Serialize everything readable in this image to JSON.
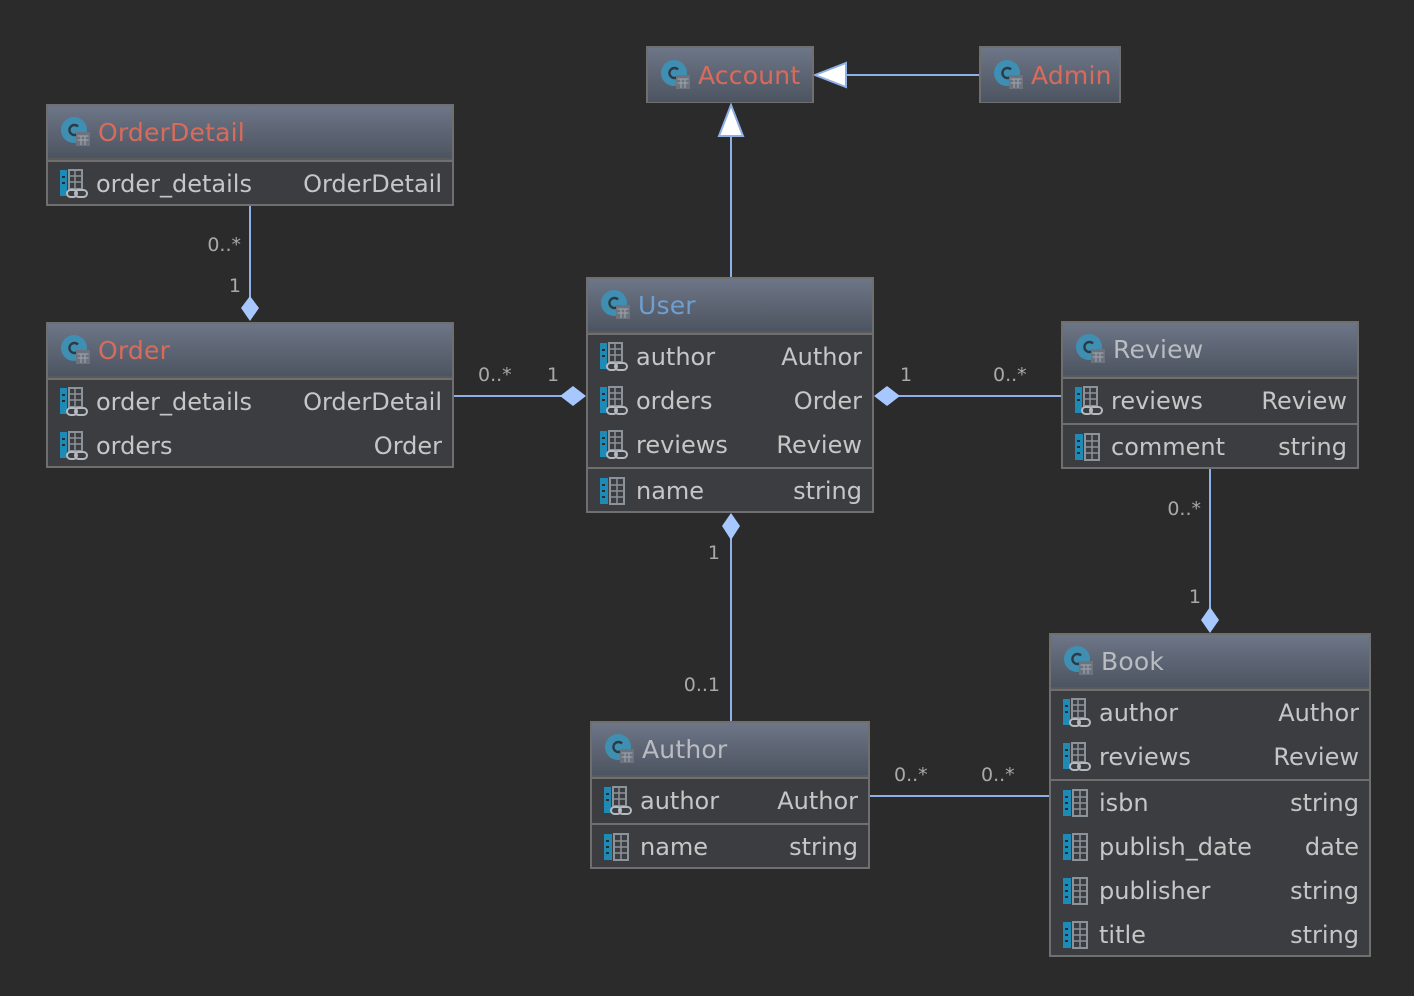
{
  "diagram": {
    "colors": {
      "background": "#2b2b2b",
      "edge": "#8fb0e6",
      "marker_fill": "#a7c7ff",
      "title_red": "#d96b5b",
      "title_blue": "#6f9fcf",
      "title_grey": "#b9bcc0",
      "text": "#c6c6c6",
      "label": "#a9a9a9"
    },
    "nodes": {
      "account": {
        "title": "Account",
        "title_style": "red",
        "icon": "class-icon"
      },
      "admin": {
        "title": "Admin",
        "title_style": "red",
        "icon": "class-icon"
      },
      "order_detail": {
        "title": "OrderDetail",
        "title_style": "red",
        "icon": "class-icon",
        "sections": [
          [
            {
              "name": "order_details",
              "type": "OrderDetail",
              "icon": "relation-field-icon"
            }
          ]
        ]
      },
      "order": {
        "title": "Order",
        "title_style": "red",
        "icon": "class-icon",
        "sections": [
          [
            {
              "name": "order_details",
              "type": "OrderDetail",
              "icon": "relation-field-icon"
            },
            {
              "name": "orders",
              "type": "Order",
              "icon": "relation-field-icon"
            }
          ]
        ]
      },
      "user": {
        "title": "User",
        "title_style": "blue",
        "icon": "class-icon",
        "sections": [
          [
            {
              "name": "author",
              "type": "Author",
              "icon": "relation-field-icon"
            },
            {
              "name": "orders",
              "type": "Order",
              "icon": "relation-field-icon"
            },
            {
              "name": "reviews",
              "type": "Review",
              "icon": "relation-field-icon"
            }
          ],
          [
            {
              "name": "name",
              "type": "string",
              "icon": "column-field-icon"
            }
          ]
        ]
      },
      "review": {
        "title": "Review",
        "title_style": "grey",
        "icon": "class-icon",
        "sections": [
          [
            {
              "name": "reviews",
              "type": "Review",
              "icon": "relation-field-icon"
            }
          ],
          [
            {
              "name": "comment",
              "type": "string",
              "icon": "column-field-icon"
            }
          ]
        ]
      },
      "author": {
        "title": "Author",
        "title_style": "grey",
        "icon": "class-icon",
        "sections": [
          [
            {
              "name": "author",
              "type": "Author",
              "icon": "relation-field-icon"
            }
          ],
          [
            {
              "name": "name",
              "type": "string",
              "icon": "column-field-icon"
            }
          ]
        ]
      },
      "book": {
        "title": "Book",
        "title_style": "grey",
        "icon": "class-icon",
        "sections": [
          [
            {
              "name": "author",
              "type": "Author",
              "icon": "relation-field-icon"
            },
            {
              "name": "reviews",
              "type": "Review",
              "icon": "relation-field-icon"
            }
          ],
          [
            {
              "name": "isbn",
              "type": "string",
              "icon": "column-field-icon"
            },
            {
              "name": "publish_date",
              "type": "date",
              "icon": "column-field-icon"
            },
            {
              "name": "publisher",
              "type": "string",
              "icon": "column-field-icon"
            },
            {
              "name": "title",
              "type": "string",
              "icon": "column-field-icon"
            }
          ]
        ]
      }
    },
    "edges": [
      {
        "id": "admin-account",
        "kind": "inheritance",
        "from": "Admin",
        "to": "Account",
        "labels": []
      },
      {
        "id": "user-account",
        "kind": "inheritance",
        "from": "User",
        "to": "Account",
        "labels": []
      },
      {
        "id": "orderdetail-order",
        "kind": "composition",
        "from": "OrderDetail",
        "to": "Order",
        "labels": [
          "0..*",
          "1"
        ]
      },
      {
        "id": "order-user",
        "kind": "composition",
        "from": "Order",
        "to": "User",
        "labels": [
          "0..*",
          "1"
        ]
      },
      {
        "id": "review-user",
        "kind": "composition",
        "from": "Review",
        "to": "User",
        "labels": [
          "1",
          "0..*"
        ]
      },
      {
        "id": "author-user",
        "kind": "composition",
        "from": "Author",
        "to": "User",
        "labels": [
          "1",
          "0..1"
        ]
      },
      {
        "id": "review-book",
        "kind": "composition",
        "from": "Review",
        "to": "Book",
        "labels": [
          "0..*",
          "1"
        ]
      },
      {
        "id": "author-book",
        "kind": "association",
        "from": "Author",
        "to": "Book",
        "labels": [
          "0..*",
          "0..*"
        ]
      }
    ]
  }
}
